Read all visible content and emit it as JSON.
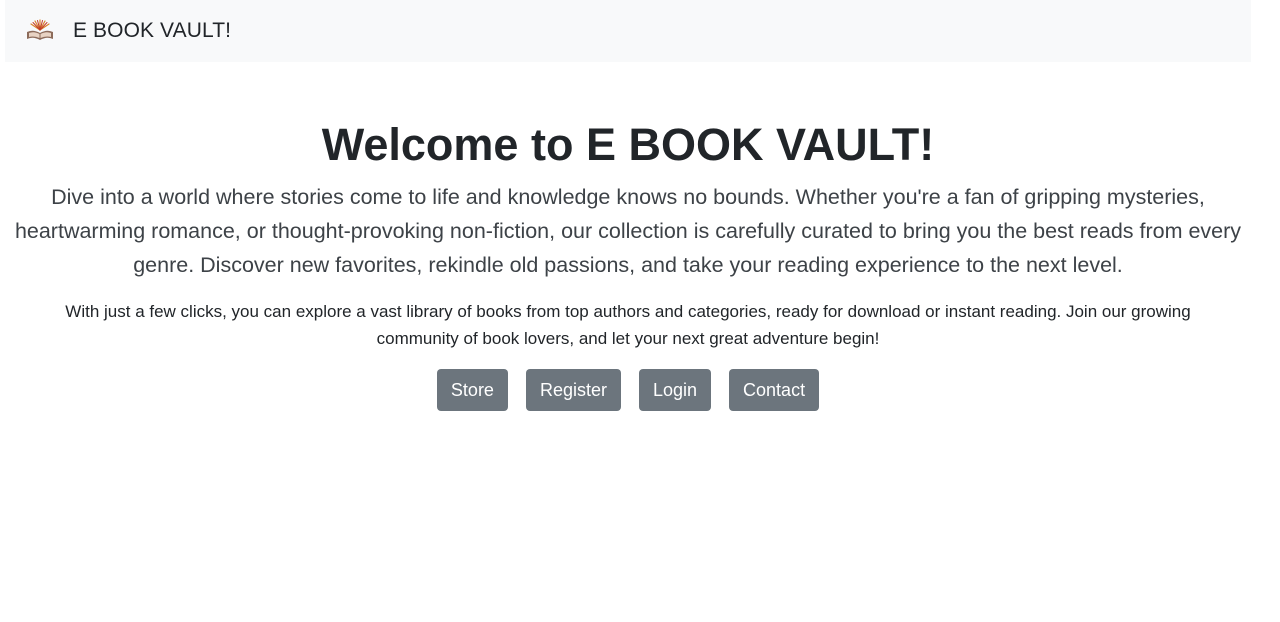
{
  "navbar": {
    "brand_text": "E BOOK VAULT!",
    "logo_icon": "open-book-icon"
  },
  "hero": {
    "title": "Welcome to E BOOK VAULT!",
    "lead": "Dive into a world where stories come to life and knowledge knows no bounds. Whether you're a fan of gripping mysteries, heartwarming romance, or thought-provoking non-fiction, our collection is carefully curated to bring you the best reads from every genre. Discover new favorites, rekindle old passions, and take your reading experience to the next level.",
    "text": "With just a few clicks, you can explore a vast library of books from top authors and categories, ready for download or instant reading. Join our growing community of book lovers, and let your next great adventure begin!"
  },
  "buttons": {
    "store": "Store",
    "register": "Register",
    "login": "Login",
    "contact": "Contact"
  },
  "colors": {
    "navbar_bg": "#f8f9fa",
    "button_bg": "#6c757d",
    "button_text": "#ffffff",
    "text": "#212529"
  }
}
